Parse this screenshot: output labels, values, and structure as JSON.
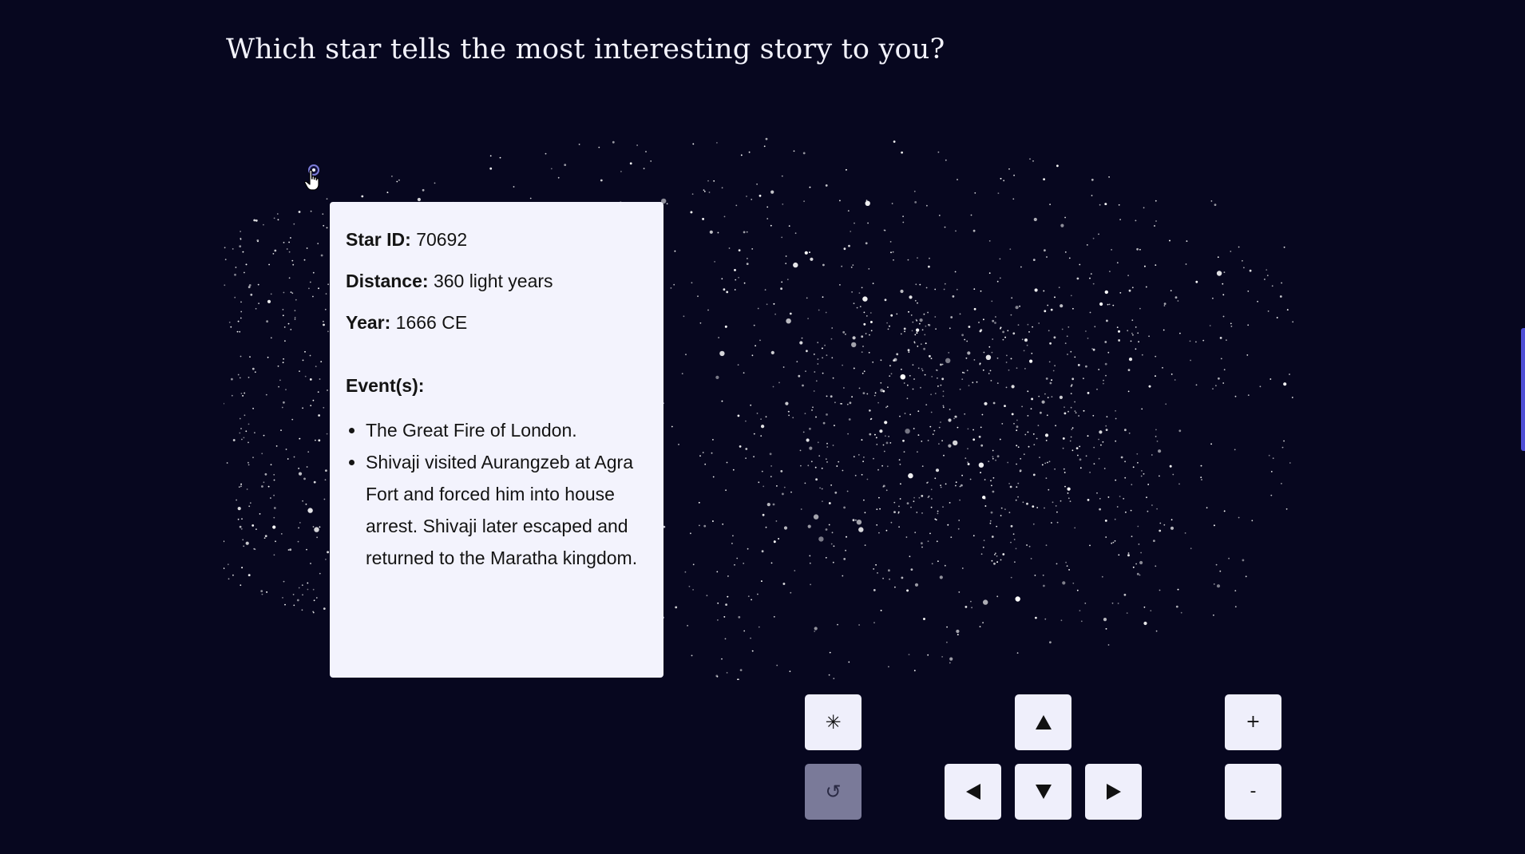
{
  "question": "Which star tells the most interesting story to you?",
  "tooltip": {
    "star_id_label": "Star ID:",
    "star_id_value": "70692",
    "distance_label": "Distance:",
    "distance_value": "360 light years",
    "year_label": "Year:",
    "year_value": "1666 CE",
    "events_label": "Event(s):",
    "events": [
      "The Great Fire of London.",
      "Shivaji visited Aurangzeb at Agra Fort and forced him into house arrest. Shivaji later escaped and returned to the Maratha kingdom."
    ]
  },
  "controls": {
    "center_glyph": "✳",
    "reset_glyph": "↺",
    "zoom_in_glyph": "+",
    "zoom_out_glyph": "-",
    "icons": {
      "center": "asterisk-icon",
      "reset": "reset-icon",
      "up": "arrow-up-icon",
      "down": "arrow-down-icon",
      "left": "arrow-left-icon",
      "right": "arrow-right-icon"
    }
  },
  "colors": {
    "background": "#07071f",
    "tooltip_background": "#f3f3fd",
    "button_background": "#efeffb",
    "button_disabled": "#7a7a99",
    "accent": "#4e4fd6",
    "highlight_ring": "#7b7bd8",
    "star": "#ffffff"
  }
}
